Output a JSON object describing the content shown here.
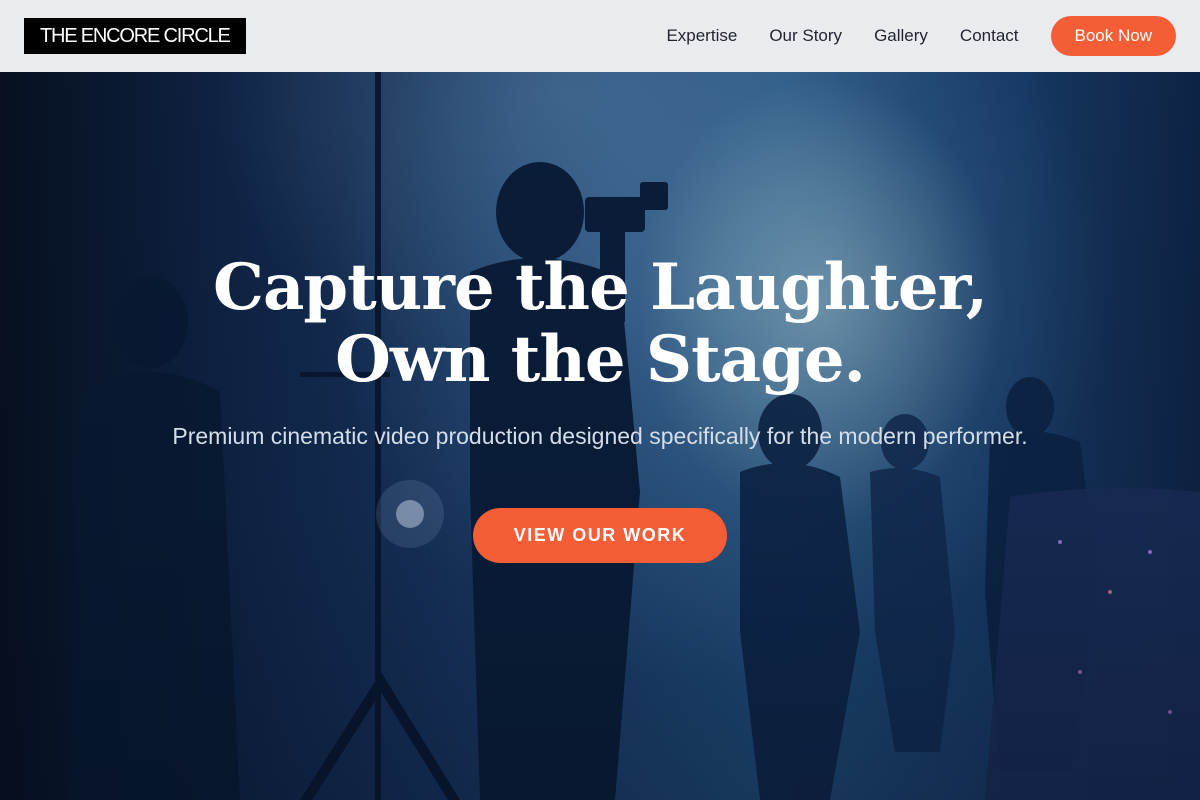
{
  "header": {
    "logo": "THE ENCORE CIRCLE",
    "nav": [
      {
        "label": "Expertise"
      },
      {
        "label": "Our Story"
      },
      {
        "label": "Gallery"
      },
      {
        "label": "Contact"
      }
    ],
    "book_label": "Book Now"
  },
  "hero": {
    "title_line1": "Capture the Laughter,",
    "title_line2": "Own the Stage.",
    "subtitle": "Premium cinematic video production designed specifically for the modern performer.",
    "cta_label": "VIEW OUR WORK",
    "background_description": "stage-film-crew-silhouettes"
  },
  "colors": {
    "accent": "#f45d35",
    "header_bg": "#e9ebef",
    "logo_bg": "#000000"
  }
}
